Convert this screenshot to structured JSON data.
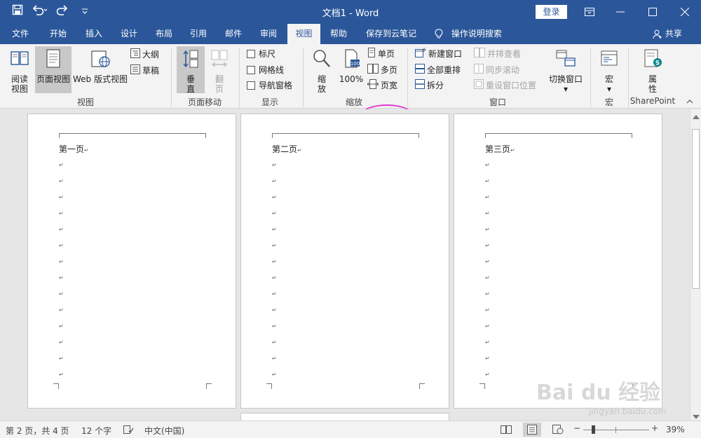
{
  "window": {
    "title": "文档1 - Word",
    "login_label": "登录",
    "minimize_icon": "minimize-icon",
    "maximize_icon": "maximize-icon",
    "close_icon": "close-icon"
  },
  "tabs": [
    {
      "label": "文件"
    },
    {
      "label": "开始"
    },
    {
      "label": "插入"
    },
    {
      "label": "设计"
    },
    {
      "label": "布局"
    },
    {
      "label": "引用"
    },
    {
      "label": "邮件"
    },
    {
      "label": "审阅"
    },
    {
      "label": "视图",
      "active": true
    },
    {
      "label": "帮助"
    },
    {
      "label": "保存到云笔记"
    }
  ],
  "tell_me": "操作说明搜索",
  "share": "共享",
  "ribbon": {
    "views": {
      "group_label": "视图",
      "read_mode": "阅读\n视图",
      "read_mode_l1": "阅读",
      "read_mode_l2": "视图",
      "print_layout": "页面视图",
      "web_layout": "Web 版式视图",
      "outline": "大纲",
      "draft": "草稿"
    },
    "page_movement": {
      "group_label": "页面移动",
      "vertical_l1": "垂",
      "vertical_l2": "直",
      "side_l1": "翻",
      "side_l2": "页"
    },
    "show": {
      "group_label": "显示",
      "ruler": "标尺",
      "gridlines": "网格线",
      "nav_pane": "导航窗格"
    },
    "zoom": {
      "group_label": "缩放",
      "zoom_l1": "缩",
      "zoom_l2": "放",
      "hundred": "100%",
      "one_page": "单页",
      "multiple_pages": "多页",
      "page_width": "页宽"
    },
    "window": {
      "group_label": "窗口",
      "new_window": "新建窗口",
      "arrange_all": "全部重排",
      "split": "拆分",
      "side_by_side": "并排查看",
      "sync_scroll": "同步滚动",
      "reset_position": "重设窗口位置",
      "switch_windows": "切换窗口"
    },
    "macros": {
      "group_label": "宏",
      "macros": "宏"
    },
    "sharepoint": {
      "group_label": "SharePoint",
      "properties_l1": "属",
      "properties_l2": "性"
    }
  },
  "pages": [
    {
      "title": "第一页"
    },
    {
      "title": "第二页"
    },
    {
      "title": "第三页"
    }
  ],
  "status": {
    "page": "第 2 页，共 4 页",
    "words": "12 个字",
    "language": "中文(中国)",
    "zoom": "39%"
  },
  "watermark": {
    "main": "Bai du 经验",
    "sub": "jingyan.baidu.com"
  },
  "colors": {
    "title_bar": "#2b579a",
    "ribbon": "#f3f3f3",
    "annotation": "#e03ad1"
  }
}
